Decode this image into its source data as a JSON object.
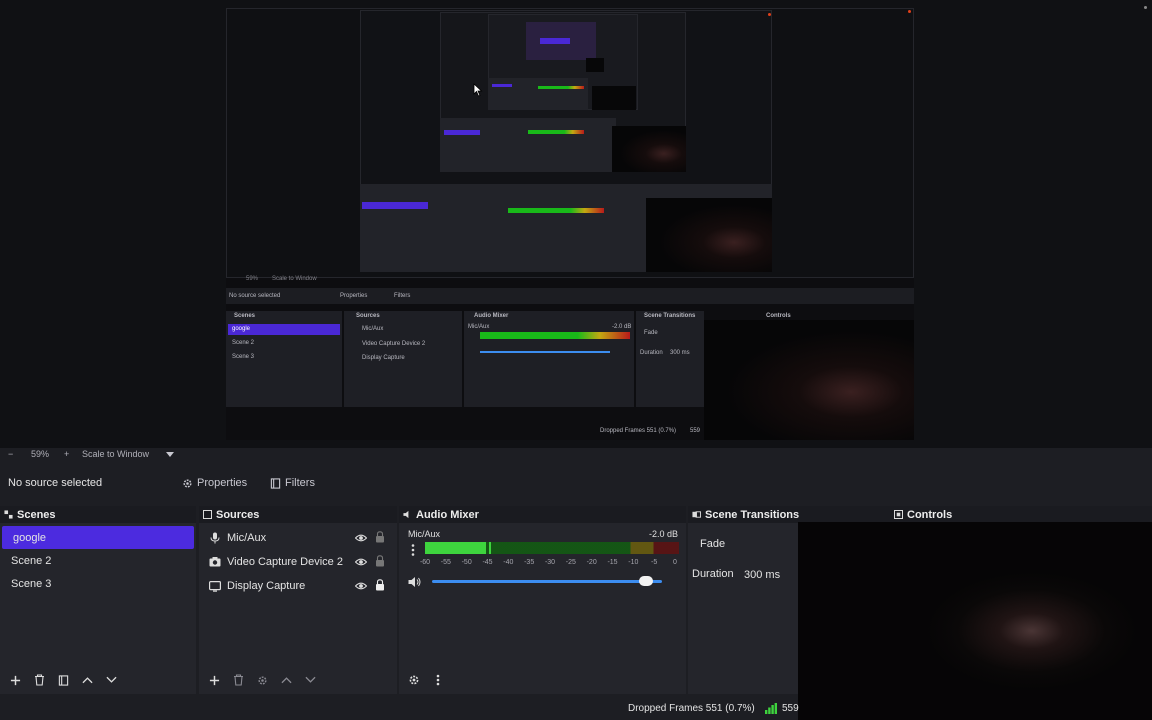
{
  "preview": {
    "nested": {
      "no_source": "No source selected",
      "properties": "Properties",
      "filters": "Filters",
      "scenes_title": "Scenes",
      "sources_title": "Sources",
      "mixer_title": "Audio Mixer",
      "transitions_title": "Scene Transitions",
      "controls_title": "Controls",
      "scenes": [
        "google",
        "Scene 2",
        "Scene 3"
      ],
      "sources": [
        "Mic/Aux",
        "Video Capture Device 2",
        "Display Capture"
      ],
      "mixer_name": "Mic/Aux",
      "mixer_db": "-2.0 dB",
      "transition": "Fade",
      "duration_label": "Duration",
      "duration_value": "300 ms",
      "zoom": "59%",
      "scale_mode": "Scale to Window",
      "dropped_frames": "Dropped Frames 551 (0.7%)",
      "bitrate": "559"
    }
  },
  "zoom_bar": {
    "minus": "−",
    "zoom_level": "59%",
    "plus": "+",
    "scale_mode": "Scale to Window"
  },
  "context_bar": {
    "no_source": "No source selected",
    "properties_label": "Properties",
    "filters_label": "Filters"
  },
  "scenes_dock": {
    "title": "Scenes",
    "items": [
      {
        "label": "google",
        "active": true
      },
      {
        "label": "Scene 2",
        "active": false
      },
      {
        "label": "Scene 3",
        "active": false
      }
    ]
  },
  "sources_dock": {
    "title": "Sources",
    "items": [
      {
        "label": "Mic/Aux",
        "icon": "microphone-icon",
        "visible": true,
        "locked": false
      },
      {
        "label": "Video Capture Device 2",
        "icon": "camera-icon",
        "visible": true,
        "locked": false
      },
      {
        "label": "Display Capture",
        "icon": "monitor-icon",
        "visible": true,
        "locked": true
      }
    ]
  },
  "audio_mixer": {
    "title": "Audio Mixer",
    "channel_name": "Mic/Aux",
    "volume_db": "-2.0 dB",
    "meter_level_fraction": 0.24,
    "meter_peak_fraction": 0.25,
    "volume_fraction": 0.93,
    "ticks": [
      "-60",
      "-55",
      "-50",
      "-45",
      "-40",
      "-35",
      "-30",
      "-25",
      "-20",
      "-15",
      "-10",
      "-5",
      "0"
    ]
  },
  "scene_transitions": {
    "title": "Scene Transitions",
    "transition": "Fade",
    "duration_label": "Duration",
    "duration_value": "300 ms"
  },
  "controls": {
    "title": "Controls"
  },
  "status_bar": {
    "dropped_frames": "Dropped Frames 551 (0.7%)",
    "bitrate": "559"
  },
  "colors": {
    "accent": "#4c2bdf",
    "background": "#1d1e23",
    "dock": "#24252b",
    "meter_green": "#3ed43e",
    "meter_yellow": "#c3a812",
    "meter_red": "#b81a1a"
  }
}
